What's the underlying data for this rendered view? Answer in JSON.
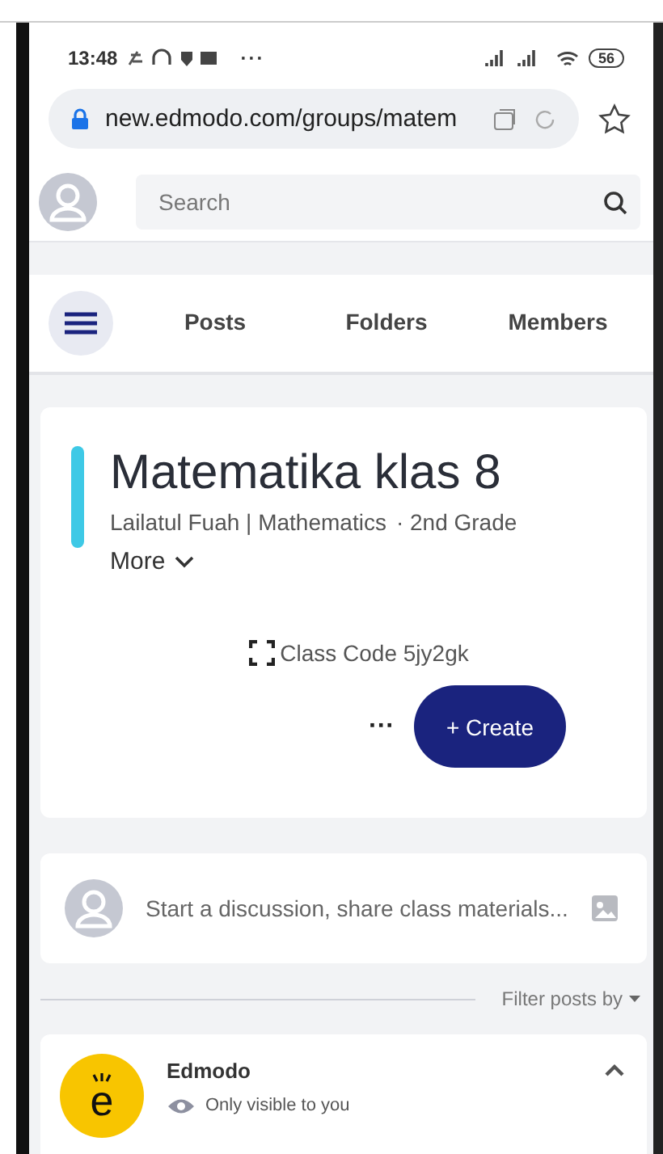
{
  "status_bar": {
    "time": "13:48",
    "more": "···",
    "battery": "56"
  },
  "browser": {
    "url": "new.edmodo.com/groups/matem"
  },
  "search": {
    "placeholder": "Search"
  },
  "tabs": [
    {
      "label": "Posts",
      "selected": false
    },
    {
      "label": "Folders",
      "selected": false
    },
    {
      "label": "Members",
      "selected": false
    }
  ],
  "class_card": {
    "title": "Matematika klas 8",
    "teacher": "Lailatul Fuah | Mathematics",
    "grade": "· 2nd Grade",
    "more": "More",
    "class_code": "Class Code 5jy2gk",
    "more_actions": "···",
    "create_button": "+ Create"
  },
  "composer": {
    "placeholder": "Start a discussion, share class materials..."
  },
  "filter": {
    "label": "Filter posts by"
  },
  "post": {
    "logo_letter": "e",
    "author": "Edmodo",
    "visibility": "Only visible to you",
    "expanded": true
  }
}
